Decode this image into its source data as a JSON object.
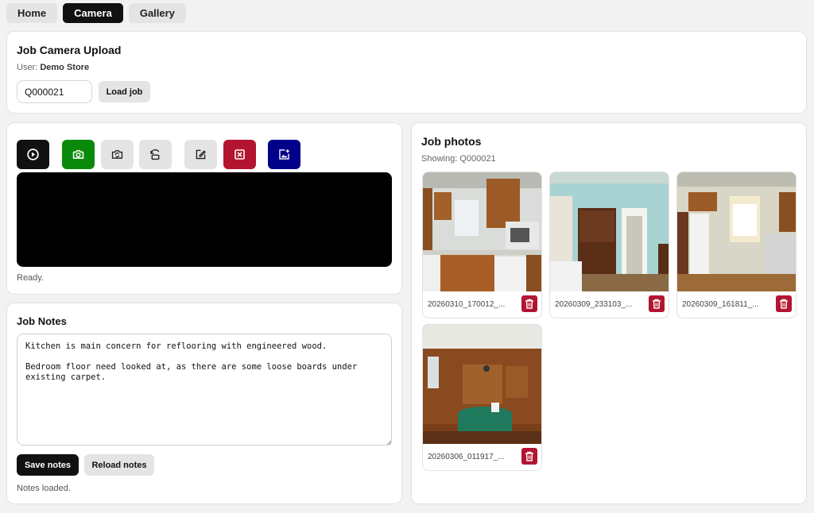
{
  "nav": {
    "tabs": [
      {
        "label": "Home"
      },
      {
        "label": "Camera"
      },
      {
        "label": "Gallery"
      }
    ],
    "active": "Camera"
  },
  "upload": {
    "title": "Job Camera Upload",
    "user_label": "User:",
    "user_name": "Demo Store",
    "job_value": "Q000021",
    "load_label": "Load job"
  },
  "camera": {
    "buttons": [
      {
        "icon": "play-circle-icon",
        "color": "#111111"
      },
      {
        "icon": "camera-icon",
        "color": "#0a8a0a"
      },
      {
        "icon": "switch-camera-icon",
        "color": "#e4e4e4"
      },
      {
        "icon": "rotate-image-icon",
        "color": "#e4e4e4"
      },
      {
        "icon": "edit-icon",
        "color": "#e4e4e4"
      },
      {
        "icon": "close-square-icon",
        "color": "#b3142f"
      },
      {
        "icon": "add-image-icon",
        "color": "#00008b"
      }
    ],
    "status": "Ready."
  },
  "notes": {
    "title": "Job Notes",
    "text": "Kitchen is main concern for reflooring with engineered wood.\n\nBedroom floor need looked at, as there are some loose boards under\nexisting carpet.",
    "save_label": "Save notes",
    "reload_label": "Reload notes",
    "status": "Notes loaded."
  },
  "photos": {
    "title": "Job photos",
    "showing_label": "Showing: Q000021",
    "items": [
      {
        "caption": "20260310_170012_...",
        "scene": "kitchen"
      },
      {
        "caption": "20260309_233103_...",
        "scene": "bedroom"
      },
      {
        "caption": "20260309_161811_...",
        "scene": "kitchen-window"
      },
      {
        "caption": "20260306_011917_...",
        "scene": "dining-room"
      }
    ]
  }
}
